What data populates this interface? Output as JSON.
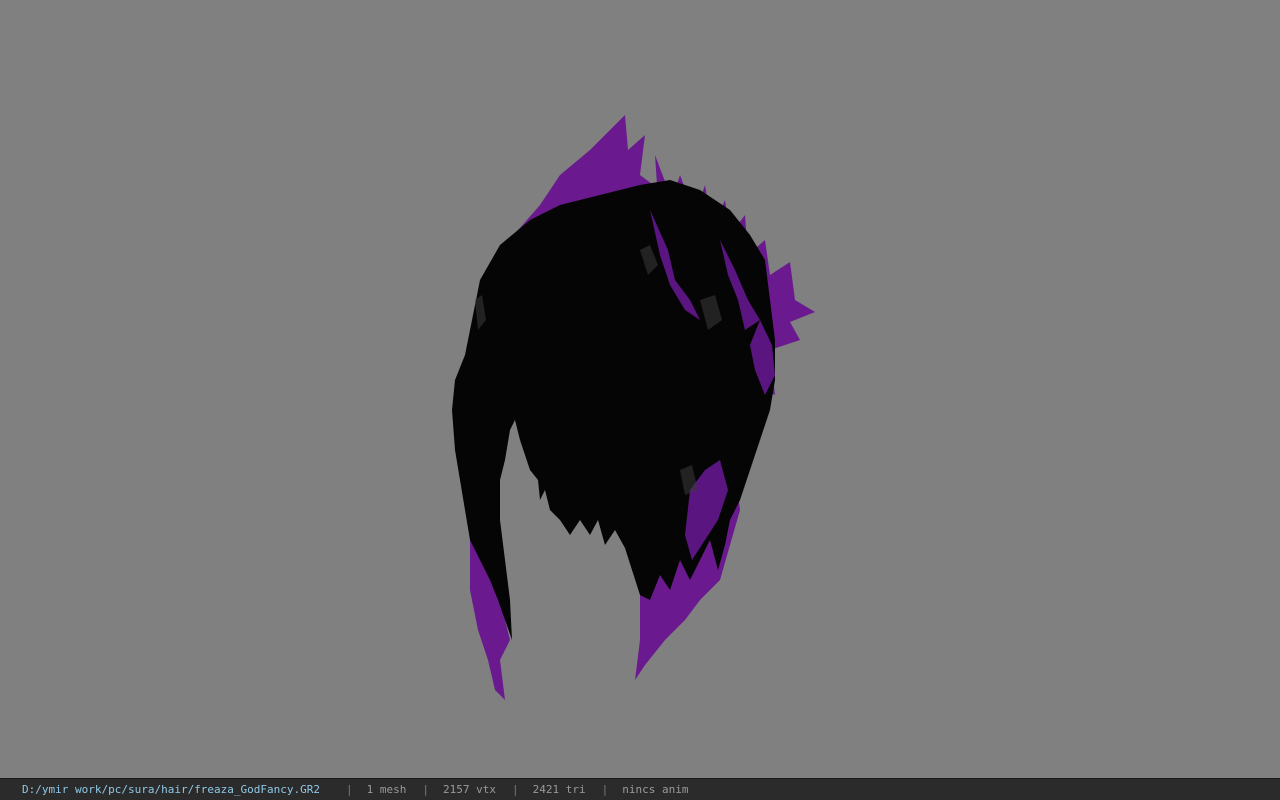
{
  "viewport": {
    "background_color": "#808080",
    "model": {
      "name": "hair-mesh",
      "primary_color": "#050505",
      "accent_color": "#6a1a8e"
    }
  },
  "status_bar": {
    "file_path": "D:/ymir work/pc/sura/hair/freaza_GodFancy.GR2",
    "separator": "|",
    "mesh_count": "1 mesh",
    "vertex_count": "2157 vtx",
    "triangle_count": "2421 tri",
    "anim_status": "nincs anim"
  }
}
